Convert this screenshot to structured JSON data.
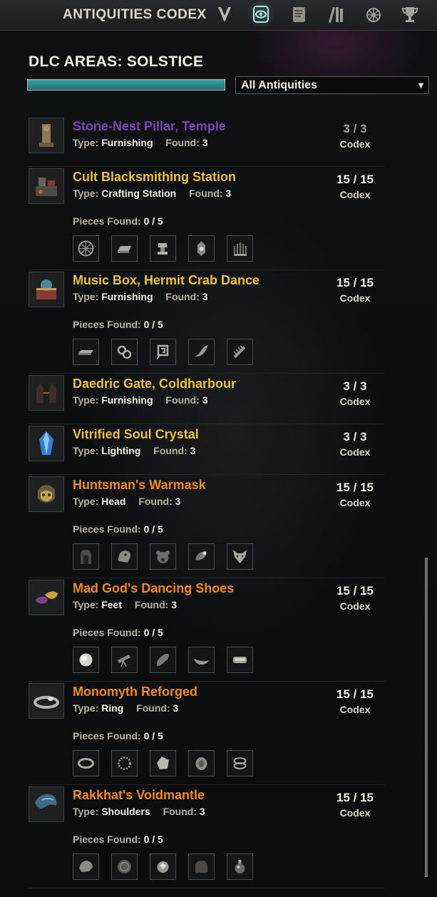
{
  "app": {
    "title": "ANTIQUITIES CODEX"
  },
  "tabs": [
    {
      "name": "scrying-tab",
      "icon": "v-rune-icon"
    },
    {
      "name": "codex-tab",
      "icon": "eye-scroll-icon",
      "active": true
    },
    {
      "name": "leads-tab",
      "icon": "scroll-icon"
    },
    {
      "name": "progress-tab",
      "icon": "books-icon"
    },
    {
      "name": "skills-tab",
      "icon": "wheel-emblem-icon"
    },
    {
      "name": "achievements-tab",
      "icon": "trophy-icon"
    }
  ],
  "header": {
    "area_title": "DLC AREAS: SOLSTICE",
    "progress_fraction": 1.0,
    "filter": {
      "selected": "All Antiquities",
      "arrow": "▼"
    }
  },
  "labels": {
    "type": "Type:",
    "found": "Found:",
    "pieces_found": "Pieces Found:",
    "codex": "Codex"
  },
  "items": [
    {
      "name": "Stone-Nest Pillar, Temple",
      "quality": "purple",
      "type": "Furnishing",
      "found": "3",
      "count": "3 / 3",
      "dim": true
    },
    {
      "name": "Cult Blacksmithing Station",
      "quality": "gold",
      "type": "Crafting Station",
      "found": "3",
      "count": "15 / 15",
      "pieces": "0 / 5",
      "piece_icons": [
        "wheel-icon",
        "ingot-icon",
        "anvil-icon",
        "lantern-icon",
        "cage-icon"
      ]
    },
    {
      "name": "Music Box, Hermit Crab Dance",
      "quality": "gold",
      "type": "Furnishing",
      "found": "3",
      "count": "15 / 15",
      "pieces": "0 / 5",
      "piece_icons": [
        "plate-icon",
        "gears-icon",
        "key-icon",
        "shell-icon",
        "comb-icon"
      ]
    },
    {
      "name": "Daedric Gate, Coldharbour",
      "quality": "gold",
      "type": "Furnishing",
      "found": "3",
      "count": "3 / 3"
    },
    {
      "name": "Vitrified Soul Crystal",
      "quality": "gold",
      "type": "Lighting",
      "found": "3",
      "count": "3 / 3"
    },
    {
      "name": "Huntsman's Warmask",
      "quality": "orange",
      "type": "Head",
      "found": "3",
      "count": "15 / 15",
      "pieces": "0 / 5",
      "piece_icons": [
        "hood-icon",
        "beast-head-icon",
        "bear-icon",
        "horn-icon",
        "fox-icon"
      ]
    },
    {
      "name": "Mad God's Dancing Shoes",
      "quality": "orange",
      "type": "Feet",
      "found": "3",
      "count": "15 / 15",
      "pieces": "0 / 5",
      "piece_icons": [
        "orb-icon",
        "spyglass-icon",
        "sole-icon",
        "curved-shoe-icon",
        "pad-icon"
      ]
    },
    {
      "name": "Monomyth Reforged",
      "quality": "orange",
      "type": "Ring",
      "found": "3",
      "count": "15 / 15",
      "pieces": "0 / 5",
      "piece_icons": [
        "band-icon",
        "bead-ring-icon",
        "fragment-icon",
        "signet-icon",
        "coil-icon"
      ]
    },
    {
      "name": "Rakkhat's Voidmantle",
      "quality": "orange",
      "type": "Shoulders",
      "found": "3",
      "count": "15 / 15",
      "pieces": "0 / 5",
      "piece_icons": [
        "shell-plate-icon",
        "round-plate-icon",
        "gem-orb-icon",
        "pauldron-icon",
        "vial-icon"
      ]
    }
  ]
}
